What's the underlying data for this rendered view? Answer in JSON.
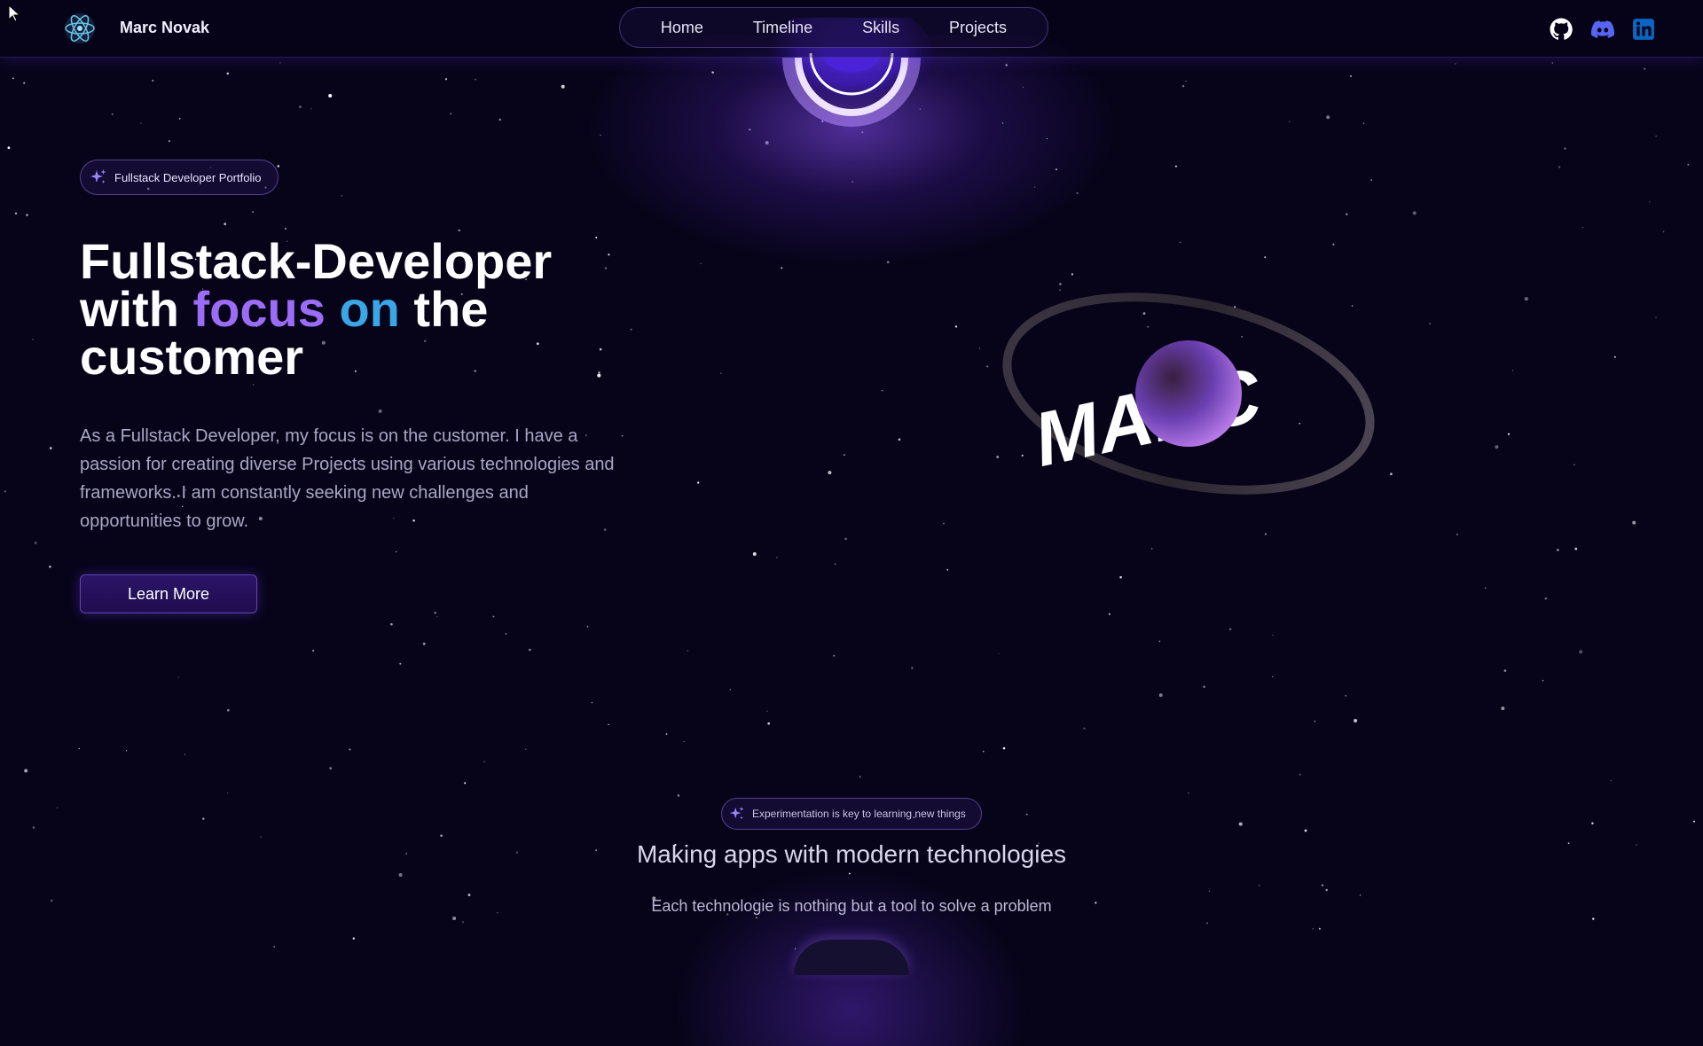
{
  "navbar": {
    "brand": "Marc Novak",
    "items": [
      {
        "label": "Home"
      },
      {
        "label": "Timeline"
      },
      {
        "label": "Skills"
      },
      {
        "label": "Projects"
      }
    ],
    "social": [
      "github-icon",
      "discord-icon",
      "linkedin-icon"
    ]
  },
  "hero": {
    "badge": "Fullstack Developer Portfolio",
    "title": {
      "line1": "Fullstack-Developer",
      "line2_start": "with ",
      "highlight1": "focus",
      "highlight2": "on",
      "line2_end": " the",
      "line3": "customer"
    },
    "description": "As a Fullstack Developer, my focus is on the customer. I have a passion for creating diverse Projects using various technologies and frameworks. I am constantly seeking new challenges and opportunities to grow.",
    "button_label": "Learn More",
    "planet_text": "MARC"
  },
  "section": {
    "badge": "Experimentation is key to learning new things",
    "title": "Making apps with modern technologies",
    "subtitle": "Each technologie is nothing but a tool to solve a problem"
  },
  "colors": {
    "background": "#07041a",
    "accent_purple": "#9b6cf6",
    "accent_blue": "#3aa6e6",
    "button": "#2b1468",
    "github": "#ffffff",
    "discord": "#5865f2",
    "linkedin": "#0a66c2"
  }
}
